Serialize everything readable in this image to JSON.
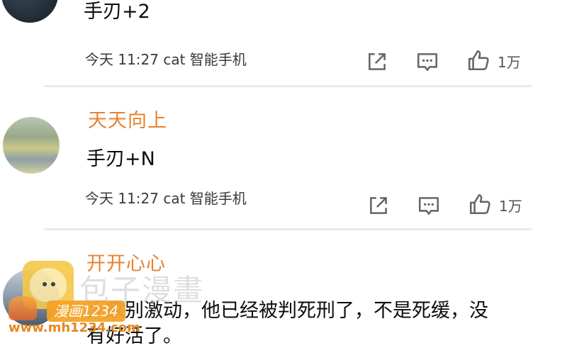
{
  "comments": [
    {
      "text": "手刃+2",
      "time": "今天 11:27",
      "device": "cat 智能手机",
      "likes": "1万"
    },
    {
      "username": "天天向上",
      "text": "手刃+N",
      "time": "今天 11:27",
      "device": "cat 智能手机",
      "likes": "1万"
    },
    {
      "username": "开开心心",
      "text_line1": "大家别激动，他已经被判死刑了，不是死缓，没",
      "text_line2": "有好活了。"
    }
  ],
  "icons": {
    "share": "share-icon",
    "comment": "comment-icon",
    "like": "thumbs-up-icon"
  },
  "watermark": {
    "site_name": "包子漫畫",
    "badge": "漫画1234",
    "url": "www.mh1234.com"
  },
  "colors": {
    "username": "#e8812f",
    "divider": "#eceae8",
    "watermark_orange": "#f4a429"
  }
}
